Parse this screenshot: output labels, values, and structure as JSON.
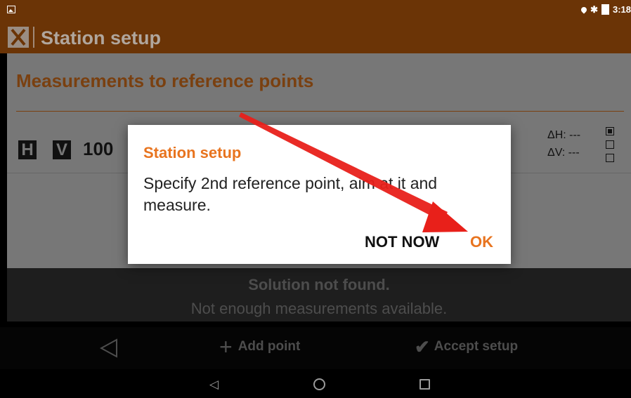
{
  "status_bar": {
    "time": "3:18",
    "bluetooth_glyph": "✱"
  },
  "app_bar": {
    "title": "Station setup",
    "logo_icon": "app-logo-icon"
  },
  "content": {
    "section_title": "Measurements to reference points",
    "row": {
      "badge_h": "H",
      "badge_v": "V",
      "value": "100",
      "delta_h": "ΔH: ---",
      "delta_v": "ΔV: ---"
    }
  },
  "solution": {
    "title": "Solution not found.",
    "subtitle": "Not enough measurements available."
  },
  "action_bar": {
    "add_point_label": "Add point",
    "accept_setup_label": "Accept setup",
    "plus_glyph": "+",
    "check_glyph": "✔"
  },
  "nav_bar": {
    "back_glyph": "◁"
  },
  "dialog": {
    "title": "Station setup",
    "message": "Specify 2nd reference point, aim at it and measure.",
    "not_now_label": "NOT NOW",
    "ok_label": "OK"
  },
  "colors": {
    "app_bar": "#6b3406",
    "accent_orange": "#e8741f",
    "annotation_arrow": "#e8201a"
  }
}
